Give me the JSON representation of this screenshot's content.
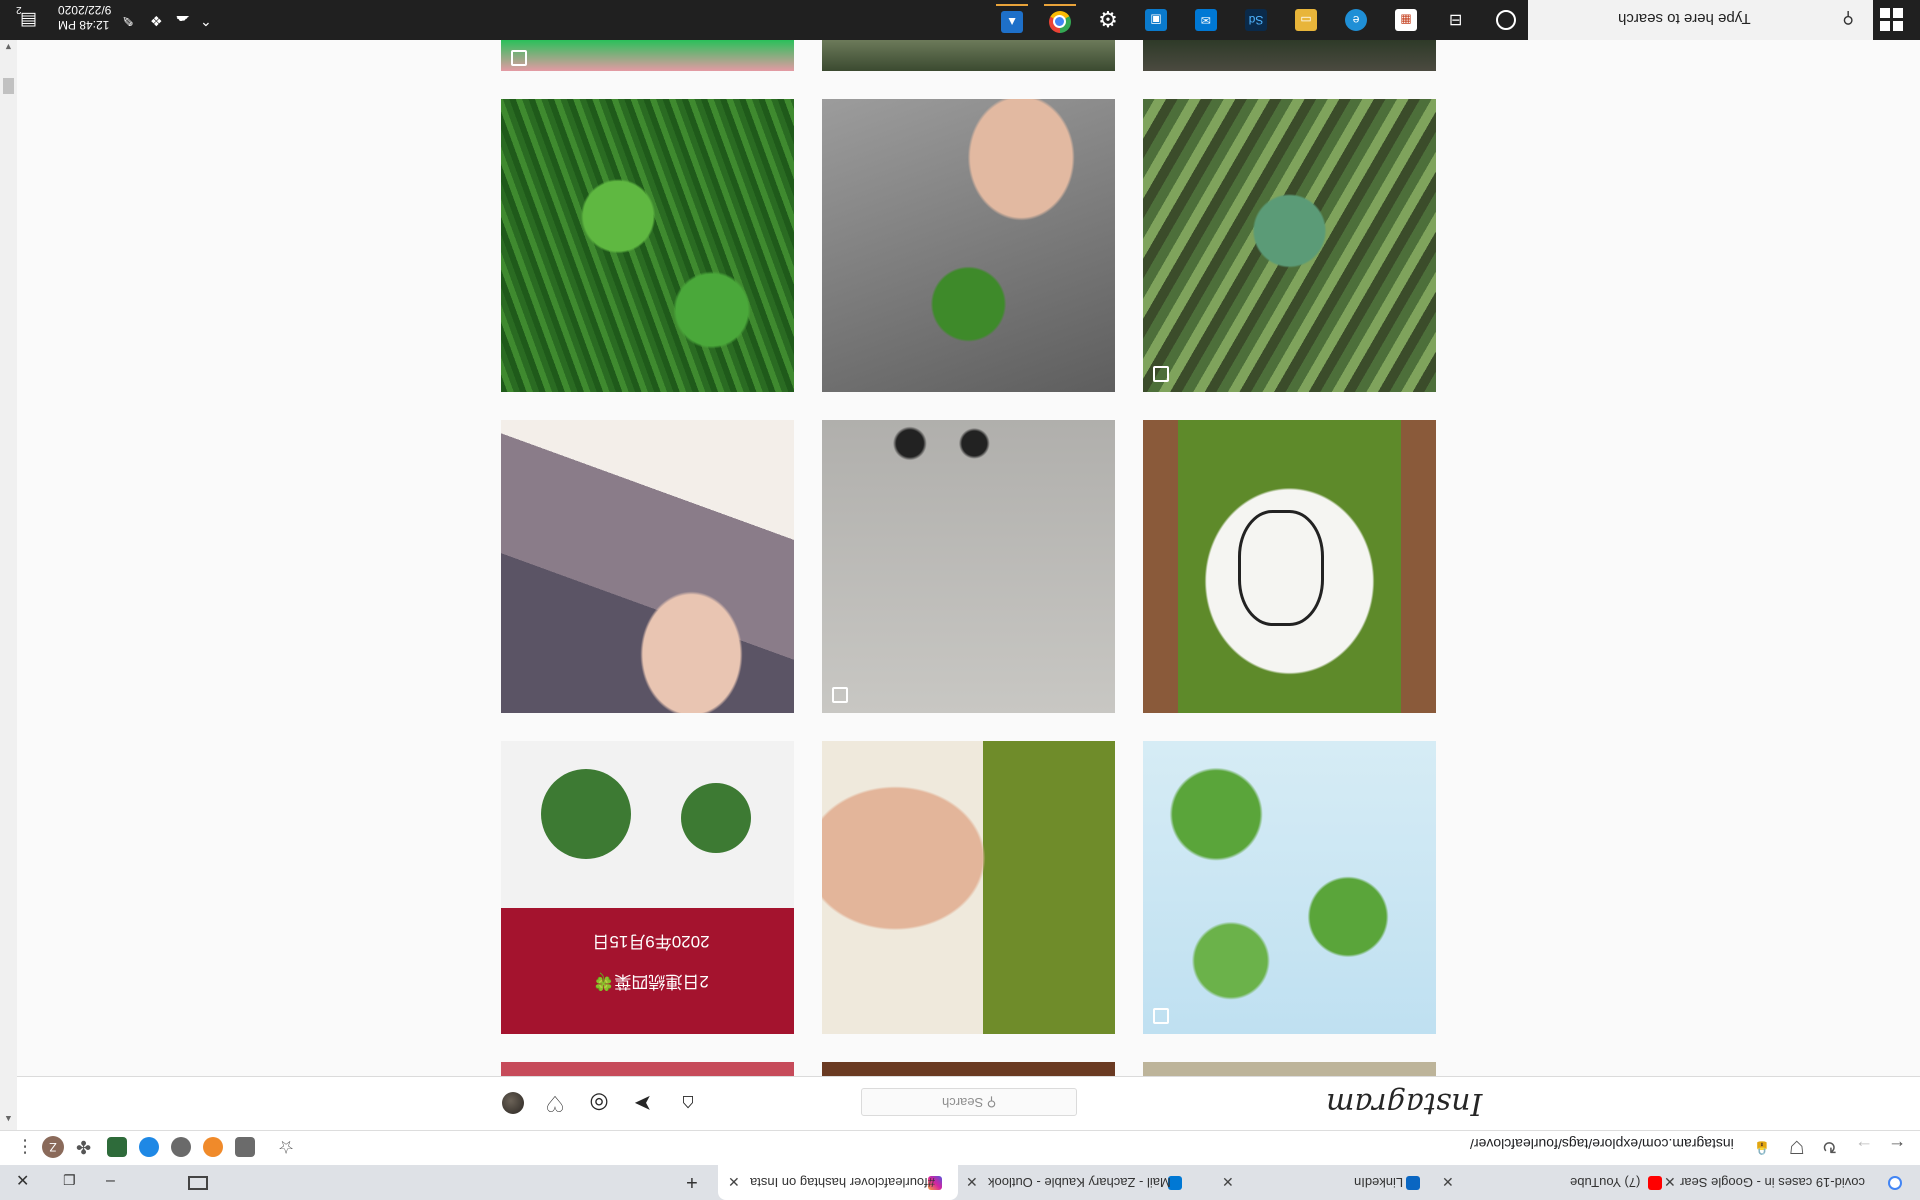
{
  "taskbar": {
    "search_placeholder": "Type here to search",
    "clock_time": "12:48 PM",
    "clock_date": "9/22/2020",
    "notification_count": "2"
  },
  "browser": {
    "url": "instagram.com/explore/tags/fourleafclover/",
    "tabs": [
      {
        "label": "covid-19 cases in - Google Sear"
      },
      {
        "label": "(7) YouTube"
      },
      {
        "label": "LinkedIn"
      },
      {
        "label": "Mail - Zachary Kauble - Outlook"
      },
      {
        "label": "#fourleafclover hashtag on Insta"
      }
    ],
    "new_tab_label": "+",
    "profile_initial": "Z"
  },
  "instagram": {
    "logo": "Instagram",
    "search_placeholder": "Search"
  },
  "photos": {
    "photo_7_caption_line1": "2020年9月15日",
    "photo_7_caption_line2": "2日連続四葉🍀"
  }
}
